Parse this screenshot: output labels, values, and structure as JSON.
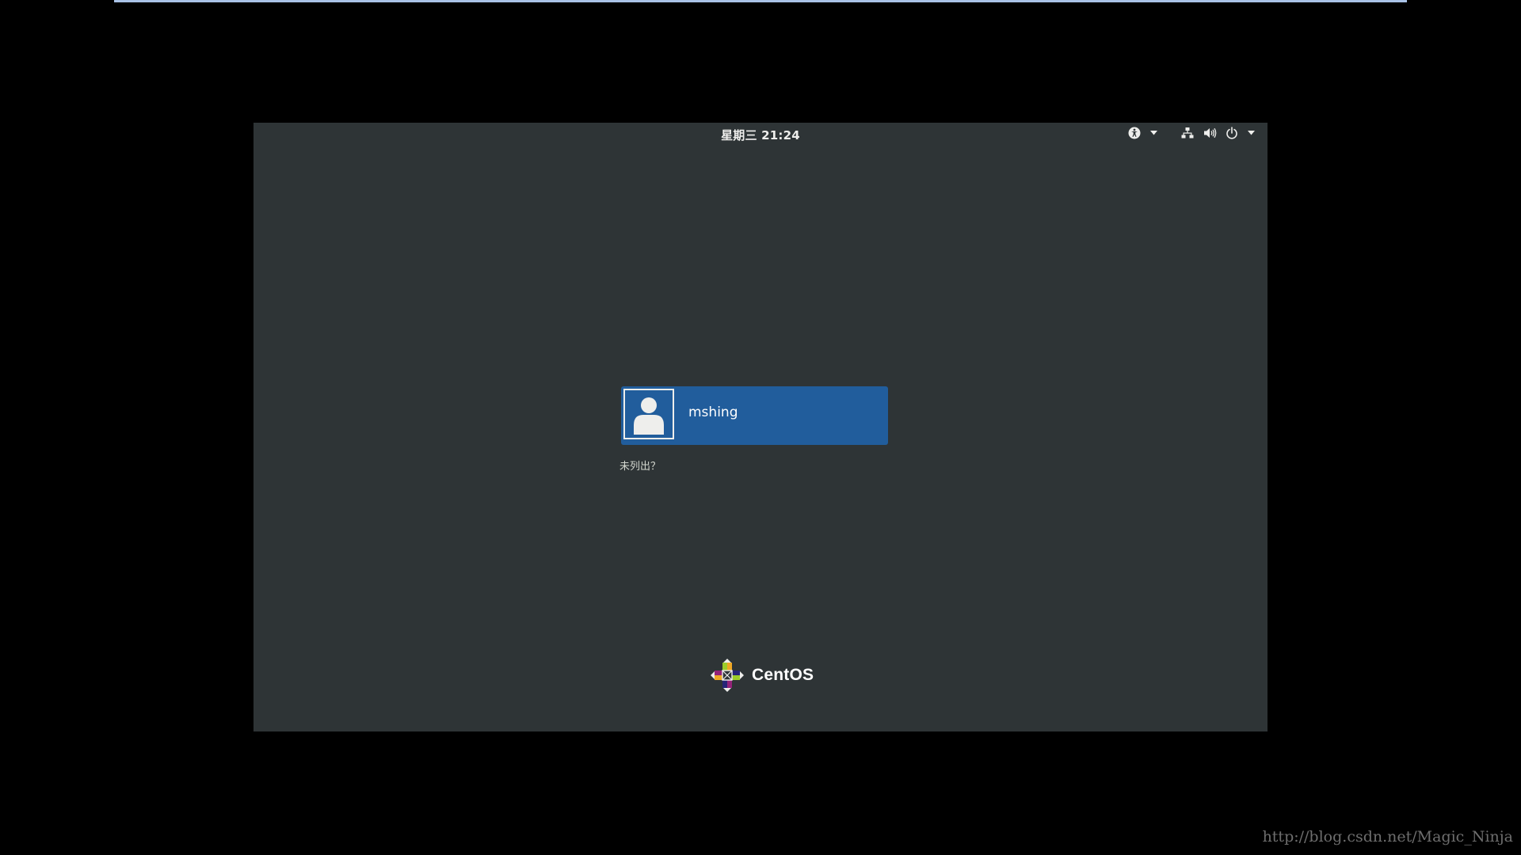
{
  "topbar": {
    "clock": "星期三 21:24"
  },
  "icons": {
    "accessibility": "accessibility-icon",
    "network": "network-wired-icon",
    "volume": "volume-icon",
    "power": "power-icon",
    "dropdown": "chevron-down-icon"
  },
  "login": {
    "user_name": "mshing",
    "not_listed": "未列出？"
  },
  "logo": {
    "text": "CentOS"
  },
  "watermark": {
    "text": "http://blog.csdn.net/Magic_Ninja"
  },
  "colors": {
    "background": "#2e3436",
    "user_card": "#215d9c",
    "text": "#eeeeec"
  }
}
